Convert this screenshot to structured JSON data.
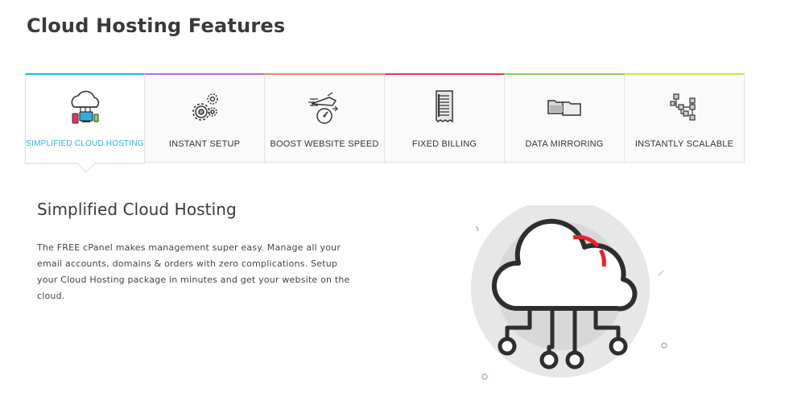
{
  "page": {
    "title": "Cloud Hosting Features"
  },
  "tabs": [
    {
      "label": "SIMPLIFIED CLOUD HOSTING",
      "icon": "cloud-devices-icon",
      "color": "#2cb0de",
      "active": true
    },
    {
      "label": "INSTANT SETUP",
      "icon": "gears-icon",
      "color": "#b86ee0",
      "active": false
    },
    {
      "label": "BOOST WEBSITE SPEED",
      "icon": "speedometer-icon",
      "color": "#ef8b5a",
      "active": false
    },
    {
      "label": "FIXED BILLING",
      "icon": "receipt-icon",
      "color": "#e8325c",
      "active": false
    },
    {
      "label": "DATA MIRRORING",
      "icon": "folders-icon",
      "color": "#8fce5b",
      "active": false
    },
    {
      "label": "INSTANTLY SCALABLE",
      "icon": "network-nodes-icon",
      "color": "#d6de5a",
      "active": false
    }
  ],
  "content": {
    "title": "Simplified Cloud Hosting",
    "body": "The FREE cPanel makes management super easy. Manage all your email accounts, domains & orders with zero complications. Setup your Cloud Hosting package in minutes and get your website on the cloud.",
    "illustration_icon": "cloud-network-icon",
    "accent_color": "#e8232b"
  }
}
